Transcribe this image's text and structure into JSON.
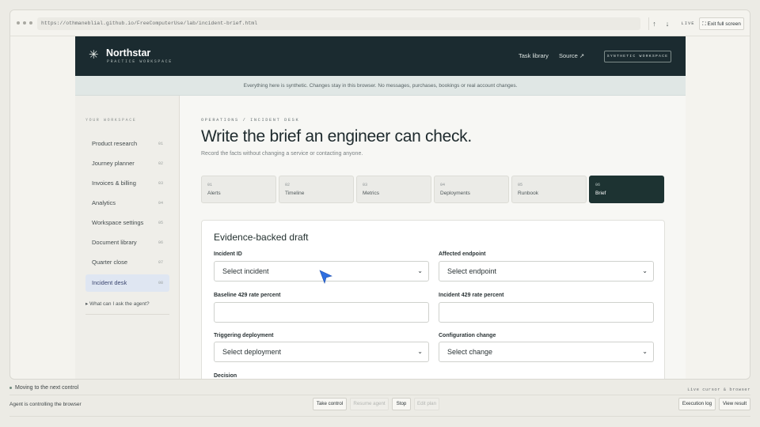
{
  "browser": {
    "url": "https://othmaneblial.github.io/FreeComputerUse/lab/incident-brief.html",
    "up_label": "↑",
    "down_label": "↓",
    "live_label": "LIVE",
    "exit_label": "⛶ Exit full screen"
  },
  "header": {
    "brand": "Northstar",
    "brand_sub": "PRACTICE WORKSPACE",
    "task_library": "Task library",
    "source": "Source ↗",
    "badge": "SYNTHETIC WORKSPACE"
  },
  "notice": "Everything here is synthetic. Changes stay in this browser. No messages, purchases, bookings or real account changes.",
  "sidebar": {
    "heading": "YOUR WORKSPACE",
    "items": [
      {
        "label": "Product research",
        "num": "01"
      },
      {
        "label": "Journey planner",
        "num": "02"
      },
      {
        "label": "Invoices & billing",
        "num": "03"
      },
      {
        "label": "Analytics",
        "num": "04"
      },
      {
        "label": "Workspace settings",
        "num": "05"
      },
      {
        "label": "Document library",
        "num": "06"
      },
      {
        "label": "Quarter close",
        "num": "07"
      },
      {
        "label": "Incident desk",
        "num": "08"
      }
    ],
    "ask": "▸ What can I ask the agent?"
  },
  "main": {
    "breadcrumb": "OPERATIONS / INCIDENT DESK",
    "title": "Write the brief an engineer can check.",
    "subtitle": "Record the facts without changing a service or contacting anyone.",
    "steps": [
      {
        "num": "01",
        "label": "Alerts"
      },
      {
        "num": "02",
        "label": "Timeline"
      },
      {
        "num": "03",
        "label": "Metrics"
      },
      {
        "num": "04",
        "label": "Deployments"
      },
      {
        "num": "05",
        "label": "Runbook"
      },
      {
        "num": "06",
        "label": "Brief"
      }
    ],
    "card": {
      "title": "Evidence-backed draft",
      "incident_id_label": "Incident ID",
      "incident_id_value": "Select incident",
      "endpoint_label": "Affected endpoint",
      "endpoint_value": "Select endpoint",
      "baseline_label": "Baseline 429 rate percent",
      "baseline_value": "",
      "incident_rate_label": "Incident 429 rate percent",
      "incident_rate_value": "",
      "deployment_label": "Triggering deployment",
      "deployment_value": "Select deployment",
      "config_label": "Configuration change",
      "config_value": "Select change",
      "decision_label": "Decision"
    }
  },
  "agent": {
    "status": "Moving to the next control",
    "right_label": "Live cursor & browser",
    "controlling": "Agent is controlling the browser",
    "take_control": "Take control",
    "resume_agent": "Resume agent",
    "stop": "Stop",
    "edit_plan": "Edit plan",
    "execution_log": "Execution log",
    "view_result": "View result"
  },
  "colors": {
    "header_bg": "#1b2b30",
    "active_step": "#1d3332",
    "active_nav": "#dfe6f2",
    "cursor": "#2f6fe0"
  }
}
